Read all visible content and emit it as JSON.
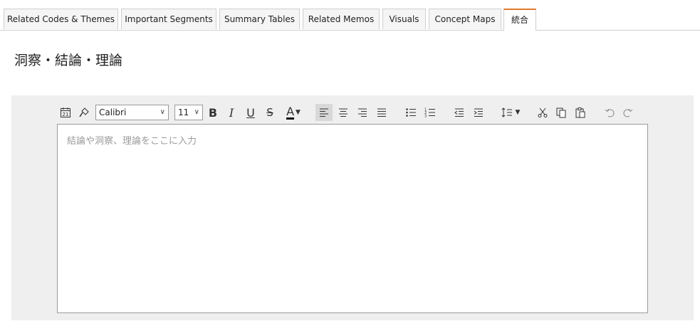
{
  "tabs": [
    {
      "label": "Related Codes & Themes"
    },
    {
      "label": "Important Segments"
    },
    {
      "label": "Summary Tables"
    },
    {
      "label": "Related Memos"
    },
    {
      "label": "Visuals"
    },
    {
      "label": "Concept Maps"
    },
    {
      "label": "統合"
    }
  ],
  "active_tab": "統合",
  "accent_color": "#e07b2f",
  "page_title": "洞察・結論・理論",
  "toolbar": {
    "font_family": "Calibri",
    "font_size": "11",
    "bold_label": "B",
    "italic_label": "I",
    "underline_label": "U",
    "strike_label": "S",
    "font_color_label": "A"
  },
  "editor": {
    "placeholder": "結論や洞察、理論をここに入力"
  }
}
